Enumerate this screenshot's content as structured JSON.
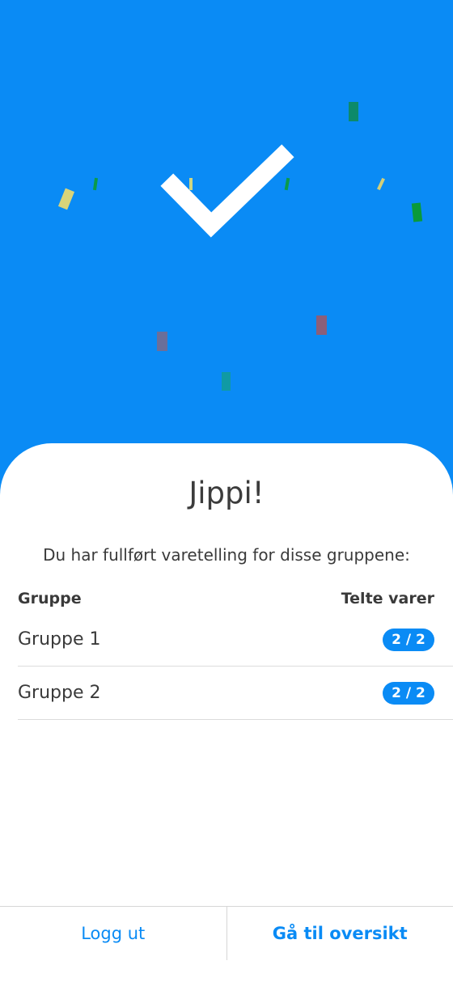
{
  "hero": {
    "background_color": "#0a8bf5",
    "icon": "checkmark-icon"
  },
  "result": {
    "title": "Jippi!",
    "subtitle": "Du har fullført varetelling for disse gruppene:"
  },
  "table": {
    "headers": {
      "group": "Gruppe",
      "counted": "Telte varer"
    },
    "rows": [
      {
        "group": "Gruppe 1",
        "counted": "2 / 2"
      },
      {
        "group": "Gruppe 2",
        "counted": "2 / 2"
      }
    ]
  },
  "footer": {
    "logout_label": "Logg ut",
    "overview_label": "Gå til oversikt"
  }
}
